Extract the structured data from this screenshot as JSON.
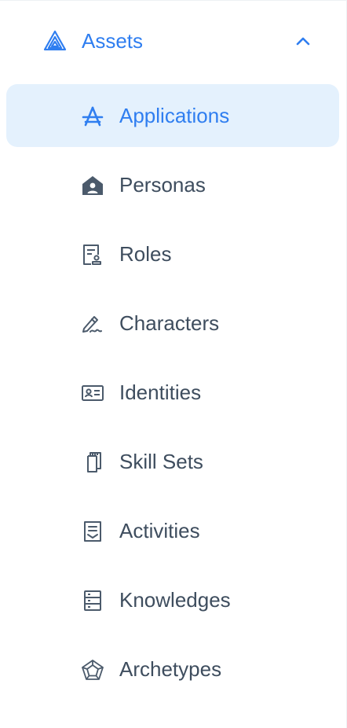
{
  "sidebar": {
    "section": {
      "label": "Assets",
      "icon": "triangle-layers-icon",
      "expanded": true,
      "chevron_icon": "chevron-up-icon"
    },
    "colors": {
      "accent": "#2f7ef0",
      "active_background": "#e4f1fd",
      "text": "#3e4d5e",
      "icon": "#4b5a6b"
    },
    "items": [
      {
        "label": "Applications",
        "icon": "app-store-icon",
        "active": true
      },
      {
        "label": "Personas",
        "icon": "house-user-icon",
        "active": false
      },
      {
        "label": "Roles",
        "icon": "document-badge-icon",
        "active": false
      },
      {
        "label": "Characters",
        "icon": "pen-signature-icon",
        "active": false
      },
      {
        "label": "Identities",
        "icon": "id-card-icon",
        "active": false
      },
      {
        "label": "Skill Sets",
        "icon": "clipboard-copy-icon",
        "active": false
      },
      {
        "label": "Activities",
        "icon": "receipt-icon",
        "active": false
      },
      {
        "label": "Knowledges",
        "icon": "server-rack-icon",
        "active": false
      },
      {
        "label": "Archetypes",
        "icon": "pentagon-web-icon",
        "active": false
      }
    ]
  }
}
